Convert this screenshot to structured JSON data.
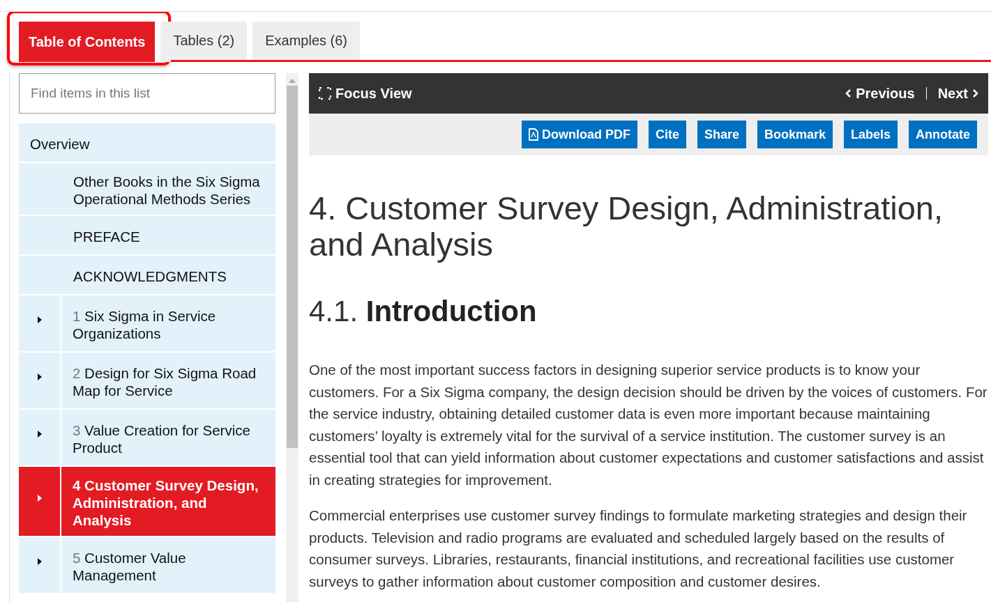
{
  "tabs": [
    {
      "label": "Table of Contents",
      "selected": true,
      "highlighted": true
    },
    {
      "label": "Tables (2)",
      "selected": false,
      "highlighted": false
    },
    {
      "label": "Examples (6)",
      "selected": false,
      "highlighted": false
    }
  ],
  "search": {
    "placeholder": "Find items in this list"
  },
  "toc": [
    {
      "kind": "heading",
      "title": "Overview",
      "selected": false
    },
    {
      "kind": "plain",
      "title": "Other Books in the Six Sigma Operational Methods Series",
      "selected": false
    },
    {
      "kind": "plain",
      "title": "PREFACE",
      "selected": false
    },
    {
      "kind": "plain",
      "title": "ACKNOWLEDGMENTS",
      "selected": false
    },
    {
      "kind": "chapter",
      "number": "1",
      "title": "Six Sigma in Service Organizations",
      "selected": false
    },
    {
      "kind": "chapter",
      "number": "2",
      "title": "Design for Six Sigma Road Map for Service",
      "selected": false
    },
    {
      "kind": "chapter",
      "number": "3",
      "title": "Value Creation for Service Product",
      "selected": false
    },
    {
      "kind": "chapter",
      "number": "4",
      "title": "Customer Survey Design, Administration, and Analysis",
      "selected": true
    },
    {
      "kind": "chapter",
      "number": "5",
      "title": "Customer Value Management",
      "selected": false
    }
  ],
  "toolbar": {
    "focus_view": "Focus View",
    "previous": "Previous",
    "next": "Next"
  },
  "actions": [
    {
      "label": "Download PDF",
      "kind": "pdf"
    },
    {
      "label": "Cite",
      "kind": "plain"
    },
    {
      "label": "Share",
      "kind": "plain"
    },
    {
      "label": "Bookmark",
      "kind": "plain"
    },
    {
      "label": "Labels",
      "kind": "plain"
    },
    {
      "label": "Annotate",
      "kind": "plain"
    }
  ],
  "article": {
    "title": "4. Customer Survey Design, Administration, and Analysis",
    "section_number": "4.1.",
    "section_title": "Introduction",
    "paragraphs": [
      "One of the most important success factors in designing superior service products is to know your customers. For a Six Sigma company, the design decision should be driven by the voices of customers. For the service industry, obtaining detailed customer data is even more important because maintaining customers’ loyalty is extremely vital for the survival of a service institution. The customer survey is an essential tool that can yield information about customer expectations and customer satisfactions and assist in creating strategies for improvement.",
      "Commercial enterprises use customer survey findings to formulate marketing strategies and design their products. Television and radio programs are evaluated and scheduled largely based on the results of consumer surveys. Libraries, restaurants, financial institutions, and recreational facilities use customer surveys to gather information about customer composition and customer desires."
    ]
  }
}
